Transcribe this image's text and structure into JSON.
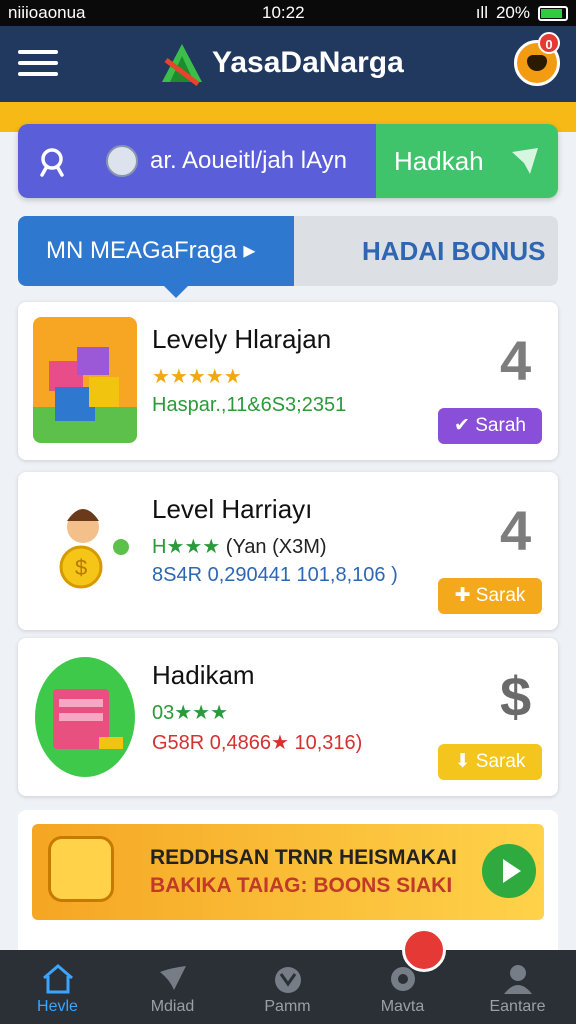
{
  "status_bar": {
    "carrier": "niiioaonua",
    "time": "10:22",
    "battery": "20%"
  },
  "header": {
    "title": "YasaDaNarga",
    "notification_count": "0"
  },
  "search": {
    "text": "ar. Aoueitl/jah lAyn",
    "button_label": "Hadkah"
  },
  "tabs": [
    {
      "label": "MN MEAGaFraga ▸",
      "active": true
    },
    {
      "label": "HADAI BONUS",
      "active": false
    }
  ],
  "cards": [
    {
      "title": "Levely Hlarajan",
      "stars": "★★★★★",
      "meta": "Haspar.,11&6S3;2351",
      "rank": "4",
      "button_label": "Sarah",
      "button_color": "#8a4fd8"
    },
    {
      "title": "Level Harriayı",
      "stars": "H★★★",
      "stars_extra": "(Yan (X3M)",
      "meta": "8S4R 0,290441 101,8,106 )",
      "rank": "4",
      "button_label": "Sarak",
      "button_color": "#f4a81c"
    },
    {
      "title": "Hadikam",
      "stars": "03★★★",
      "meta": "G58R 0,4866★ 10,316)",
      "rank": "$",
      "button_label": "Sarak",
      "button_color": "#f4c51c"
    }
  ],
  "promo": {
    "line1": "REDDHSAN TRNR HEISMAKAI",
    "line2": "BAKIKA TAIAG: BOONS SIAKI"
  },
  "bottom_nav": [
    {
      "label": "Hevle",
      "icon": "home-icon",
      "active": true
    },
    {
      "label": "Mdiad",
      "icon": "wings-icon",
      "active": false
    },
    {
      "label": "Pamm",
      "icon": "cat-icon",
      "active": false
    },
    {
      "label": "Mavta",
      "icon": "gear-icon",
      "active": false
    },
    {
      "label": "Eantare",
      "icon": "user-icon",
      "active": false
    }
  ],
  "colors": {
    "header": "#22395f",
    "accent_yellow": "#f7b916",
    "search_purple": "#5a5fd9",
    "search_green": "#3fc46b",
    "tab_blue": "#2f78d0"
  }
}
